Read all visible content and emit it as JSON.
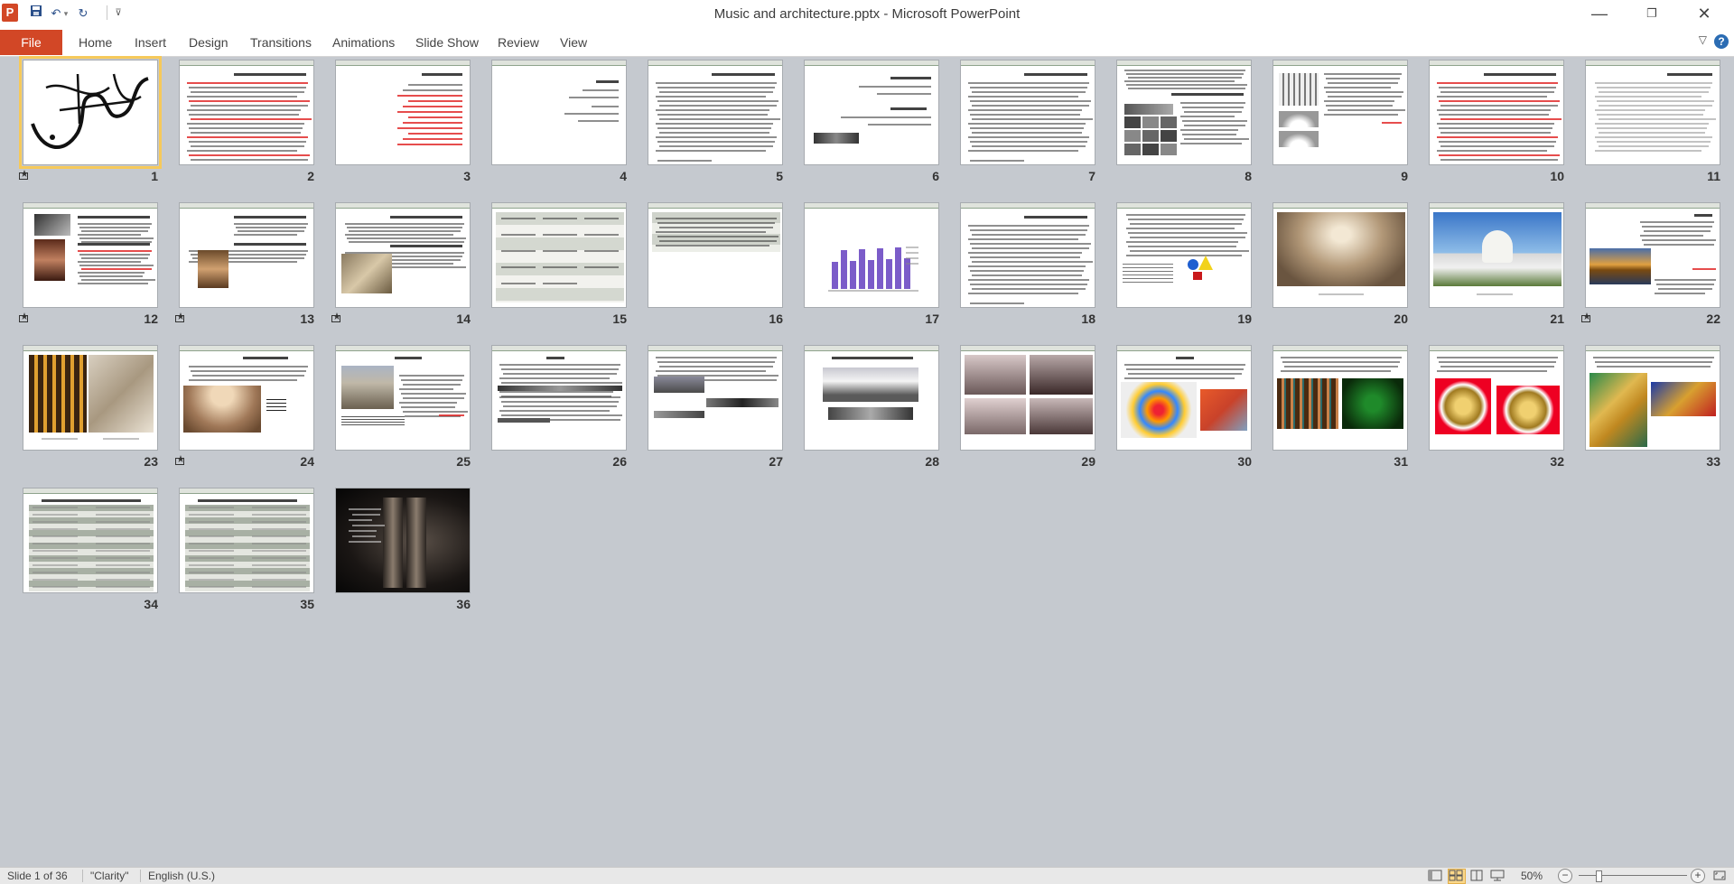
{
  "window": {
    "title": "Music and architecture.pptx - Microsoft PowerPoint",
    "app_icon": "P"
  },
  "qat": {
    "save_icon": "save-icon",
    "undo_icon": "undo-icon",
    "redo_icon": "redo-icon",
    "customize_icon": "customize-icon"
  },
  "ribbon": {
    "file_label": "File",
    "tabs": [
      "Home",
      "Insert",
      "Design",
      "Transitions",
      "Animations",
      "Slide Show",
      "Review",
      "View"
    ]
  },
  "slides": [
    {
      "num": "1",
      "kind": "calligraphy",
      "trans": true
    },
    {
      "num": "2",
      "kind": "text-red"
    },
    {
      "num": "3",
      "kind": "list-red"
    },
    {
      "num": "4",
      "kind": "sparse"
    },
    {
      "num": "5",
      "kind": "text"
    },
    {
      "num": "6",
      "kind": "sparse-pic"
    },
    {
      "num": "7",
      "kind": "text"
    },
    {
      "num": "8",
      "kind": "text-grid"
    },
    {
      "num": "9",
      "kind": "arches"
    },
    {
      "num": "10",
      "kind": "text-red"
    },
    {
      "num": "11",
      "kind": "text-gray"
    },
    {
      "num": "12",
      "kind": "portraits",
      "trans": true
    },
    {
      "num": "13",
      "kind": "portrait",
      "trans": true
    },
    {
      "num": "14",
      "kind": "painting",
      "trans": true
    },
    {
      "num": "15",
      "kind": "table"
    },
    {
      "num": "16",
      "kind": "table-short"
    },
    {
      "num": "17",
      "kind": "bar-chart"
    },
    {
      "num": "18",
      "kind": "text"
    },
    {
      "num": "19",
      "kind": "shapes"
    },
    {
      "num": "20",
      "kind": "photo-arches"
    },
    {
      "num": "21",
      "kind": "taj"
    },
    {
      "num": "22",
      "kind": "bridge",
      "trans": true
    },
    {
      "num": "23",
      "kind": "two-photos"
    },
    {
      "num": "24",
      "kind": "vaults",
      "trans": true
    },
    {
      "num": "25",
      "kind": "mosque"
    },
    {
      "num": "26",
      "kind": "text-strips"
    },
    {
      "num": "27",
      "kind": "mountain-strips"
    },
    {
      "num": "28",
      "kind": "mountain"
    },
    {
      "num": "29",
      "kind": "four-images"
    },
    {
      "num": "30",
      "kind": "colorful"
    },
    {
      "num": "31",
      "kind": "green-interior"
    },
    {
      "num": "32",
      "kind": "horns"
    },
    {
      "num": "33",
      "kind": "sax"
    },
    {
      "num": "34",
      "kind": "table-green"
    },
    {
      "num": "35",
      "kind": "table-green"
    },
    {
      "num": "36",
      "kind": "dark"
    }
  ],
  "status": {
    "slide_info": "Slide 1 of 36",
    "theme": "\"Clarity\"",
    "language": "English (U.S.)",
    "zoom": "50%"
  }
}
